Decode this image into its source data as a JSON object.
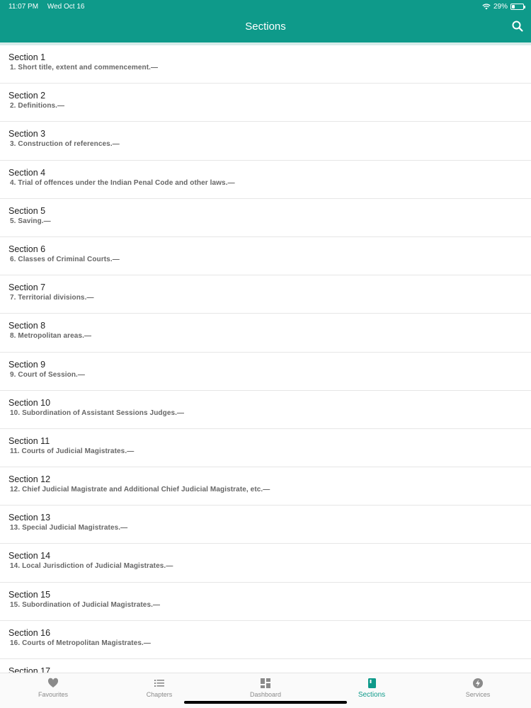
{
  "status_bar": {
    "time": "11:07 PM",
    "date": "Wed Oct 16",
    "battery": "29%",
    "battery_level": 0.29
  },
  "header": {
    "title": "Sections"
  },
  "sections": [
    {
      "title": "Section 1",
      "subtitle": "1. Short title, extent and commencement.—"
    },
    {
      "title": "Section 2",
      "subtitle": "2. Definitions.—"
    },
    {
      "title": "Section 3",
      "subtitle": "3. Construction of references.—"
    },
    {
      "title": "Section 4",
      "subtitle": "4. Trial of offences under the Indian Penal Code and other laws.—"
    },
    {
      "title": "Section 5",
      "subtitle": "5. Saving.—"
    },
    {
      "title": "Section 6",
      "subtitle": "6. Classes of Criminal Courts.—"
    },
    {
      "title": "Section 7",
      "subtitle": "7. Territorial divisions.—"
    },
    {
      "title": "Section 8",
      "subtitle": "8. Metropolitan areas.—"
    },
    {
      "title": "Section 9",
      "subtitle": "9. Court of Session.—"
    },
    {
      "title": "Section 10",
      "subtitle": "10. Subordination of Assistant Sessions Judges.—"
    },
    {
      "title": "Section 11",
      "subtitle": "11. Courts of Judicial Magistrates.—"
    },
    {
      "title": "Section 12",
      "subtitle": "12. Chief Judicial Magistrate and Additional Chief Judicial Magistrate, etc.—"
    },
    {
      "title": "Section 13",
      "subtitle": "13. Special Judicial Magistrates.—"
    },
    {
      "title": "Section 14",
      "subtitle": "14. Local Jurisdiction of Judicial Magistrates.—"
    },
    {
      "title": "Section 15",
      "subtitle": "15. Subordination of Judicial Magistrates.—"
    },
    {
      "title": "Section 16",
      "subtitle": "16. Courts of Metropolitan Magistrates.—"
    },
    {
      "title": "Section 17",
      "subtitle": ""
    }
  ],
  "tabs": [
    {
      "label": "Favourites",
      "icon": "heart-icon"
    },
    {
      "label": "Chapters",
      "icon": "list-icon"
    },
    {
      "label": "Dashboard",
      "icon": "dashboard-icon"
    },
    {
      "label": "Sections",
      "icon": "book-icon",
      "active": true
    },
    {
      "label": "Services",
      "icon": "bolt-icon"
    }
  ],
  "colors": {
    "accent": "#0e9a8a",
    "inactive": "#8a8a8a"
  }
}
